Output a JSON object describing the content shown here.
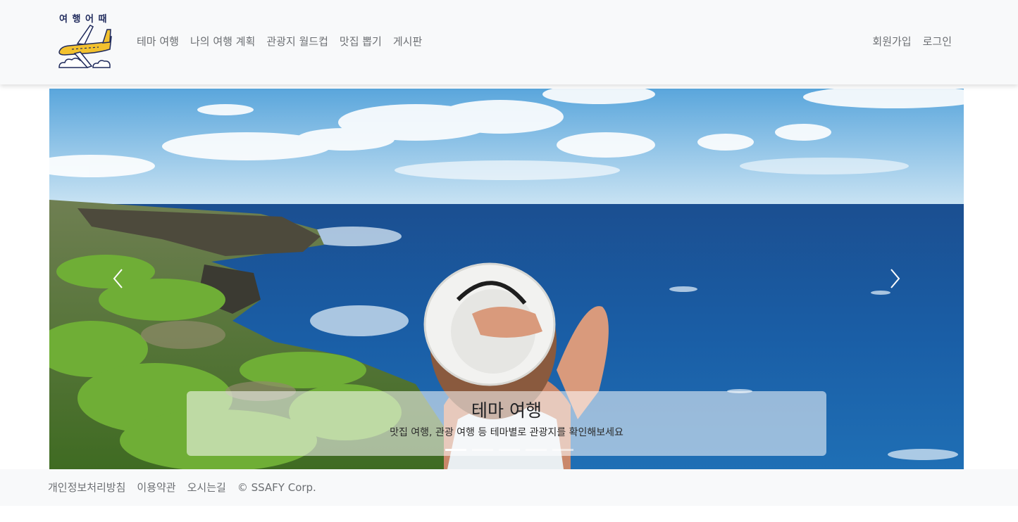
{
  "brand": {
    "logo_text": "여 행 어 때"
  },
  "nav": {
    "left": [
      "테마 여행",
      "나의 여행 계획",
      "관광지 월드컵",
      "맛집 뽑기",
      "게시판"
    ],
    "right": [
      "회원가입",
      "로그인"
    ]
  },
  "carousel": {
    "caption_title": "테마 여행",
    "caption_text": "맛집 여행, 관광 여행 등 테마별로 관광지를 확인해보세요",
    "slide_count": 5,
    "active_index": 0,
    "prev_icon": "chevron-left-icon",
    "next_icon": "chevron-right-icon"
  },
  "footer": {
    "links": [
      "개인정보처리방침",
      "이용약관",
      "오시는길"
    ],
    "copyright": "© SSAFY Corp."
  },
  "colors": {
    "navbar_bg": "#f8f9fa",
    "logo_navy": "#1f2a5c",
    "logo_yellow": "#f2c12e",
    "link_gray": "#6c6f73"
  }
}
